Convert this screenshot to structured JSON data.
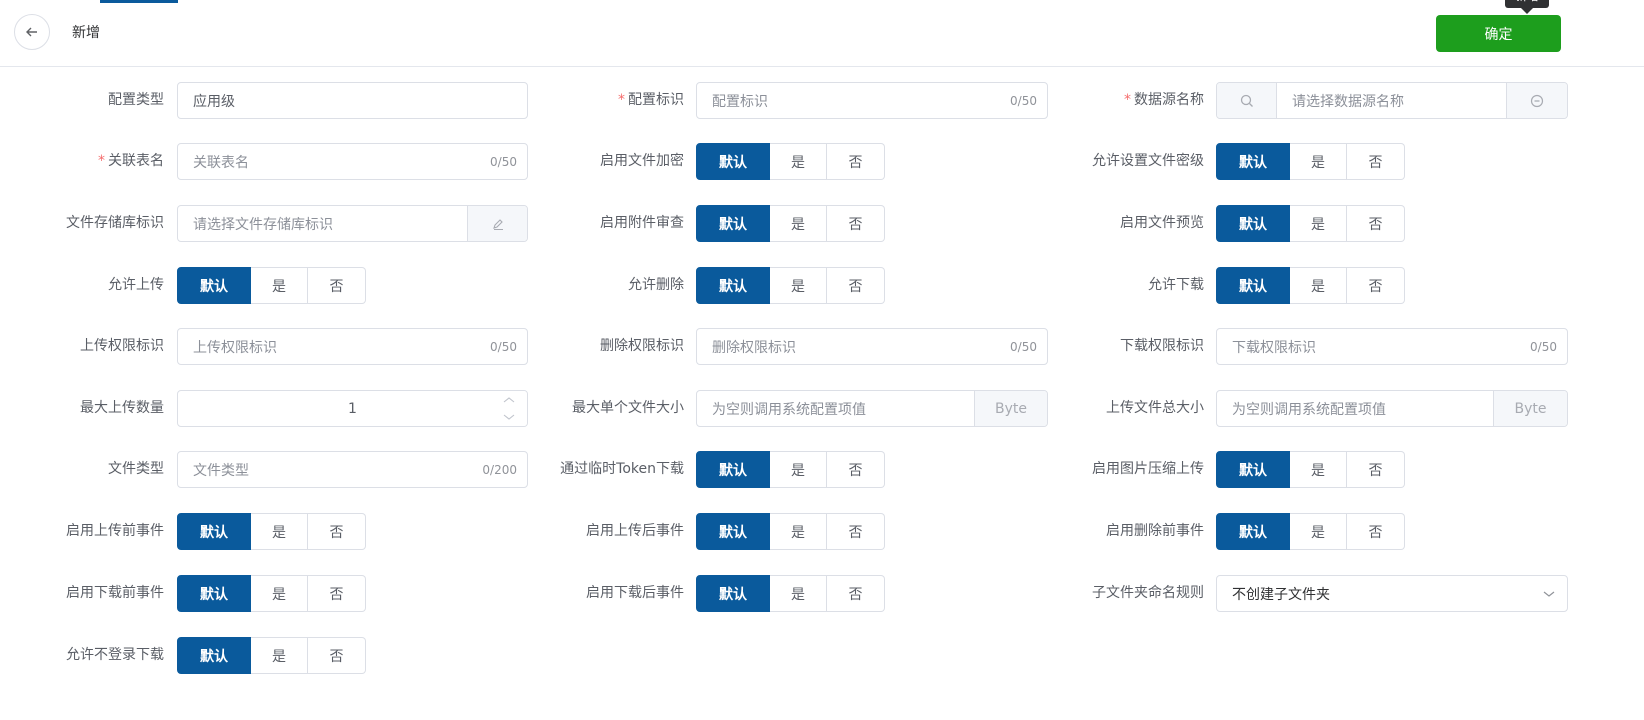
{
  "header": {
    "title": "新增",
    "confirm_label": "确定",
    "tooltip": "新增"
  },
  "form": {
    "config_type": {
      "label": "配置类型",
      "value": "应用级"
    },
    "config_id": {
      "label": "配置标识",
      "placeholder": "配置标识",
      "count": "0/50"
    },
    "datasource": {
      "label": "数据源名称",
      "placeholder": "请选择数据源名称"
    },
    "table_name": {
      "label": "关联表名",
      "placeholder": "关联表名",
      "count": "0/50"
    },
    "storage_id": {
      "label": "文件存储库标识",
      "placeholder": "请选择文件存储库标识"
    },
    "upload_perm": {
      "label": "上传权限标识",
      "placeholder": "上传权限标识",
      "count": "0/50"
    },
    "delete_perm": {
      "label": "删除权限标识",
      "placeholder": "删除权限标识",
      "count": "0/50"
    },
    "download_perm": {
      "label": "下载权限标识",
      "placeholder": "下载权限标识",
      "count": "0/50"
    },
    "max_upload_count": {
      "label": "最大上传数量",
      "value": "1"
    },
    "max_file_size": {
      "label": "最大单个文件大小",
      "placeholder": "为空则调用系统配置项值",
      "unit": "Byte"
    },
    "total_file_size": {
      "label": "上传文件总大小",
      "placeholder": "为空则调用系统配置项值",
      "unit": "Byte"
    },
    "file_type": {
      "label": "文件类型",
      "placeholder": "文件类型",
      "count": "0/200"
    },
    "subfolder_rule": {
      "label": "子文件夹命名规则",
      "value": "不创建子文件夹"
    }
  },
  "options": [
    "默认",
    "是",
    "否"
  ],
  "toggles": {
    "enable_encrypt": "启用文件加密",
    "allow_secret_level": "允许设置文件密级",
    "enable_attach_review": "启用附件审查",
    "enable_preview": "启用文件预览",
    "allow_upload": "允许上传",
    "allow_delete": "允许删除",
    "allow_download": "允许下载",
    "temp_token_download": "通过临时Token下载",
    "image_compress": "启用图片压缩上传",
    "before_upload_event": "启用上传前事件",
    "after_upload_event": "启用上传后事件",
    "before_delete_event": "启用删除前事件",
    "before_download_event": "启用下载前事件",
    "after_download_event": "启用下载后事件",
    "allow_anon_download": "允许不登录下载"
  },
  "colors": {
    "primary": "#0a5a9c",
    "confirm": "#1d9e1d",
    "required": "#f56c6c"
  },
  "icons": [
    "back-arrow-icon",
    "search-icon",
    "minus-circle-icon",
    "edit-icon",
    "chevron-up-icon",
    "chevron-down-icon"
  ]
}
